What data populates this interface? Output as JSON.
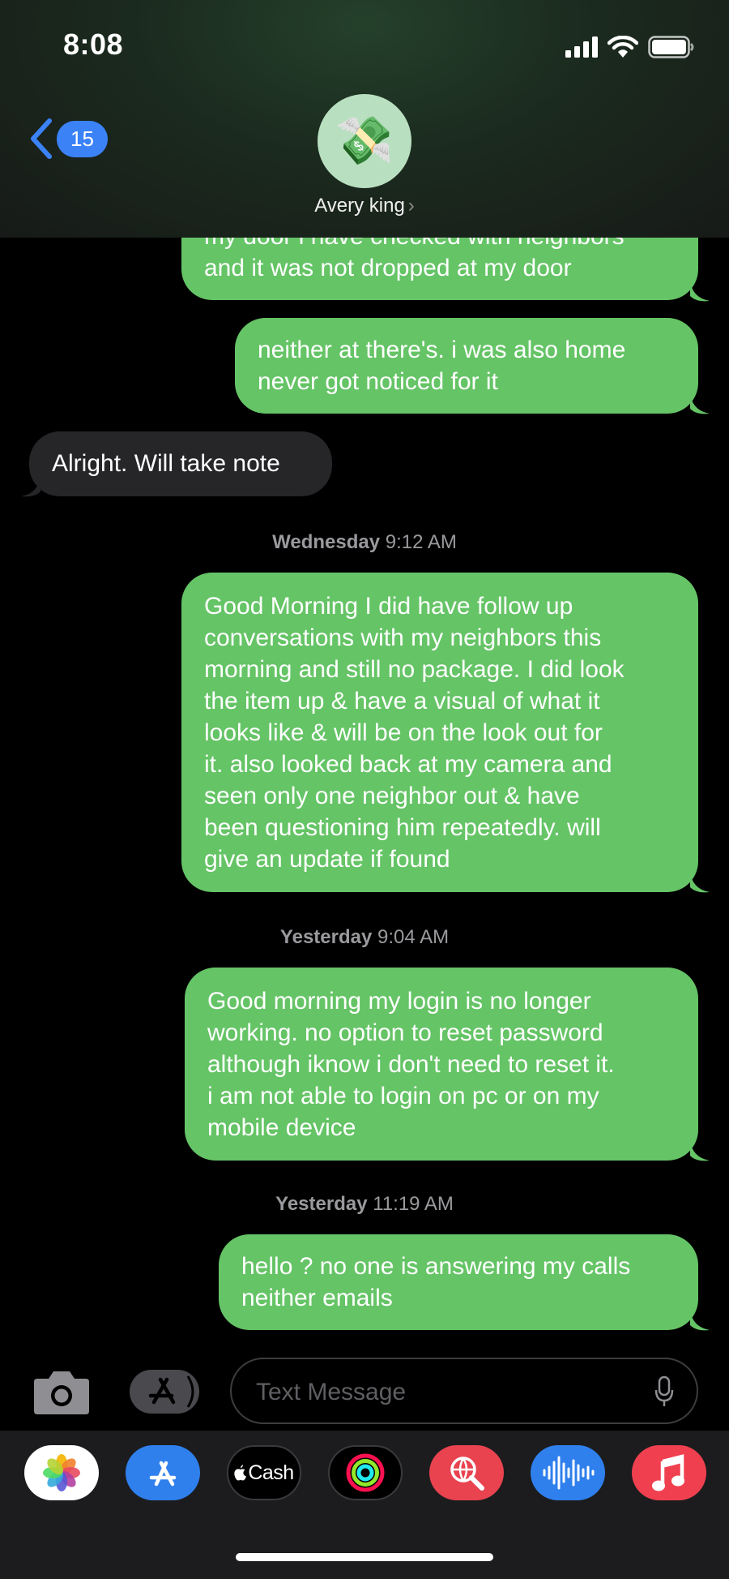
{
  "status_bar": {
    "time": "8:08"
  },
  "header": {
    "unread_count": "15",
    "contact_name": "Avery king",
    "chevron": "›",
    "avatar_emoji": "💸"
  },
  "messages": [
    {
      "side": "sent",
      "text": "my door i have checked with neighbors\nand it was not dropped at my door"
    },
    {
      "side": "sent",
      "text": "neither at there's. i was also home\nnever got noticed for it"
    },
    {
      "side": "received",
      "text": "Alright. Will take note"
    },
    {
      "side": "sent",
      "text": "Good Morning I did have follow up\nconversations with my neighbors this\nmorning and still no package. I did look\nthe item up & have a visual of what it\nlooks like & will be on the look out for\nit. also looked back at my camera and\nseen only one neighbor out & have\nbeen questioning him repeatedly. will\ngive an update if found"
    },
    {
      "side": "sent",
      "text": "Good morning my login is no longer\nworking. no option to reset password\nalthough iknow i don't need to reset it.\ni am not able to login on pc or on my\nmobile device"
    },
    {
      "side": "sent",
      "text": "hello ? no one is answering my calls\nneither emails"
    }
  ],
  "timestamps": [
    {
      "day": "Wednesday",
      "time": "9:12 AM"
    },
    {
      "day": "Yesterday",
      "time": "9:04 AM"
    },
    {
      "day": "Yesterday",
      "time": "11:19 AM"
    }
  ],
  "input": {
    "placeholder": "Text Message"
  },
  "app_drawer": {
    "cash_label": "Cash",
    "apps": [
      "photos-icon",
      "app-store-icon",
      "apple-cash-icon",
      "fitness-icon",
      "web-images-icon",
      "audio-message-icon",
      "music-icon"
    ]
  },
  "colors": {
    "sent_bubble": "#65c466",
    "received_bubble": "#262629",
    "accent": "#3b82f6",
    "background": "#000000"
  }
}
